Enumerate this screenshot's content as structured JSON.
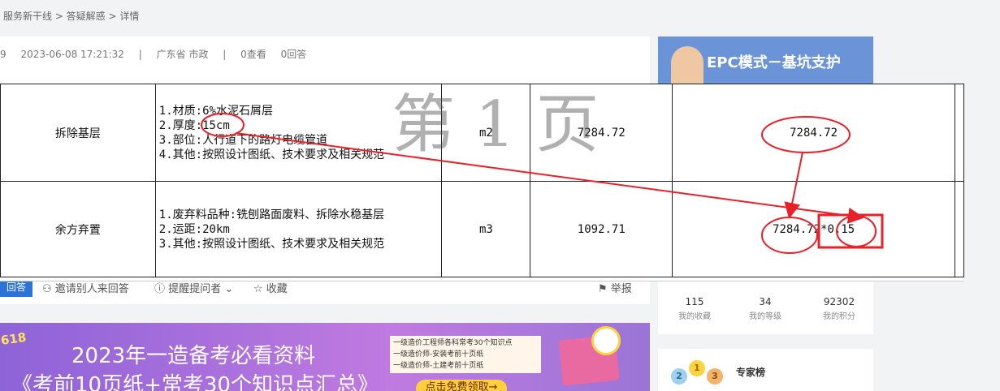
{
  "breadcrumb": "服务新干线 > 答疑解惑 > 详情",
  "meta": {
    "id_tail": "9",
    "datetime": "2023-06-08 17:21:32",
    "sep": "|",
    "region": "广东省 市政",
    "views": "0查看",
    "answers": "0回答"
  },
  "sheet": {
    "watermark": "第 1 页",
    "rows": [
      {
        "name": "拆除基层",
        "desc": [
          "1.材质:6%水泥石屑层",
          "2.厚度:15cm",
          "3.部位:人行道下的路灯电缆管道",
          "4.其他:按照设计图纸、技术要求及相关规范"
        ],
        "unit": "m2",
        "qty": "7284.72",
        "formula": "7284.72"
      },
      {
        "name": "余方弃置",
        "desc": [
          "1.废弃料品种:铣刨路面废料、拆除水稳基层",
          "2.运距:20km",
          "3.其他:按照设计图纸、技术要求及相关规范"
        ],
        "unit": "m3",
        "qty": "1092.71",
        "formula": "7284.72*0.15"
      }
    ]
  },
  "actions": {
    "answer": "回答",
    "invite": "邀请别人来回答",
    "remind": "提醒提问者",
    "favorite": "收藏",
    "report": "举报"
  },
  "banner": {
    "badge": "618",
    "title": "2023年一造备考必看资料",
    "subtitle": "《考前10页纸+常考30个知识点汇总》",
    "list": [
      "一级造价工程师各科常考30个知识点",
      "一级造价师-安装考前十页纸",
      "一级造价师-土建考前十页纸"
    ],
    "cta": "点击免费领取→"
  },
  "side_promo": {
    "title": "EPC模式－基坑支护"
  },
  "stats": [
    {
      "value": "115",
      "label": "我的收藏"
    },
    {
      "value": "34",
      "label": "我的等级"
    },
    {
      "value": "92302",
      "label": "我的积分"
    }
  ],
  "experts": {
    "title": "专家榜",
    "medals": [
      "2",
      "1",
      "3"
    ]
  },
  "colors": {
    "annotation": "#e8202a",
    "primary": "#2c73d9",
    "banner": "#a06ddc"
  }
}
